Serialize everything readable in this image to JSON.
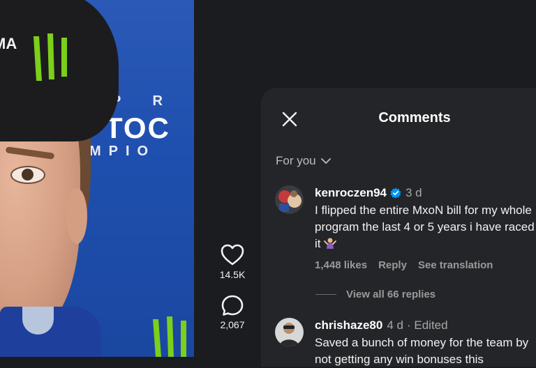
{
  "video": {
    "backdrop_top": "P R",
    "backdrop_mid": "TOC",
    "backdrop_bottom": "MPIO",
    "cap_brand": "MA"
  },
  "actions": {
    "likes_count": "14.5K",
    "comments_count": "2,067"
  },
  "sheet": {
    "title": "Comments",
    "sort_label": "For you"
  },
  "comments": [
    {
      "username": "kenroczen94",
      "verified": true,
      "time": "3 d",
      "edited": "",
      "text": "I flipped the entire MxoN bill for my whole program the last 4 or 5 years i have raced it",
      "likes": "1,448 likes",
      "reply": "Reply",
      "translate": "See translation"
    },
    {
      "username": "chrishaze80",
      "verified": false,
      "time": "4 d",
      "edited": "· Edited",
      "text": "Saved a bunch of money for the team by not getting any win bonuses this"
    }
  ],
  "view_replies": "View all 66 replies",
  "colors": {
    "sheet_bg": "#242528",
    "page_bg": "#1b1c1f",
    "verified_blue": "#0095f6",
    "backdrop_blue": "#1f4fae"
  },
  "icons": [
    "close-icon",
    "chevron-down-icon",
    "heart-icon",
    "comment-bubble-icon",
    "verified-badge-icon",
    "shrug-emoji"
  ]
}
